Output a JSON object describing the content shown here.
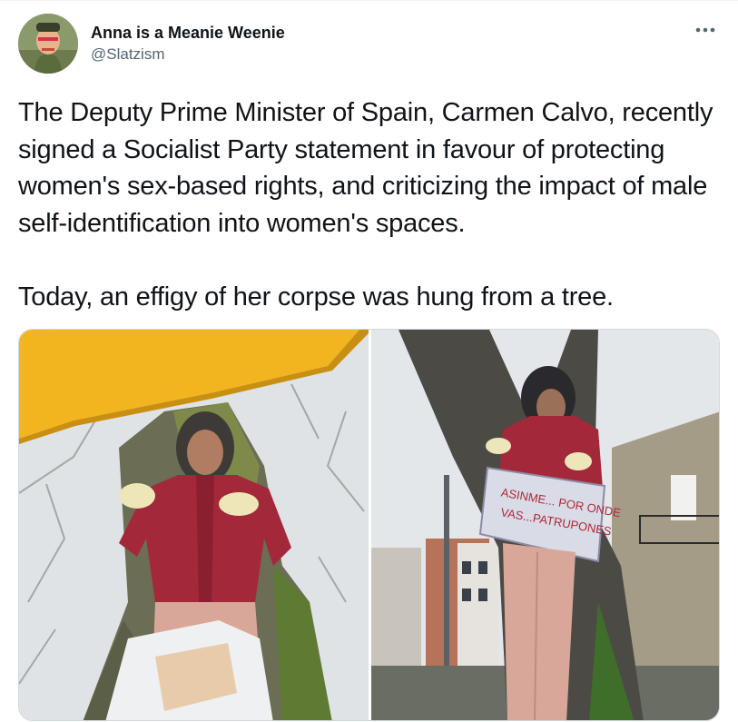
{
  "tweet": {
    "author": {
      "display_name": "Anna is a Meanie Weenie",
      "handle": "@Slatzism",
      "avatar_icon": "avatar-icon"
    },
    "more_icon": "more-horizontal-icon",
    "text": "The Deputy Prime Minister of Spain, Carmen Calvo, recently signed a Socialist Party statement in favour of protecting women's sex-based rights, and criticizing the impact of male self-identification into women's spaces.\n\nToday, an effigy of her corpse was hung from a tree.",
    "media": {
      "photos": [
        {
          "icon": "photo-effigy-umbrella-icon"
        },
        {
          "icon": "photo-effigy-sign-icon",
          "sign_text_line1": "ASINME... POR ONDE",
          "sign_text_line2": "VAS...PATRUPONES"
        }
      ]
    }
  },
  "colors": {
    "text_primary": "#0f1419",
    "text_secondary": "#536471",
    "border": "#cfd9de",
    "umbrella": "#f2b51f",
    "jacket": "#a3283a",
    "pants": "#d9a79a"
  }
}
